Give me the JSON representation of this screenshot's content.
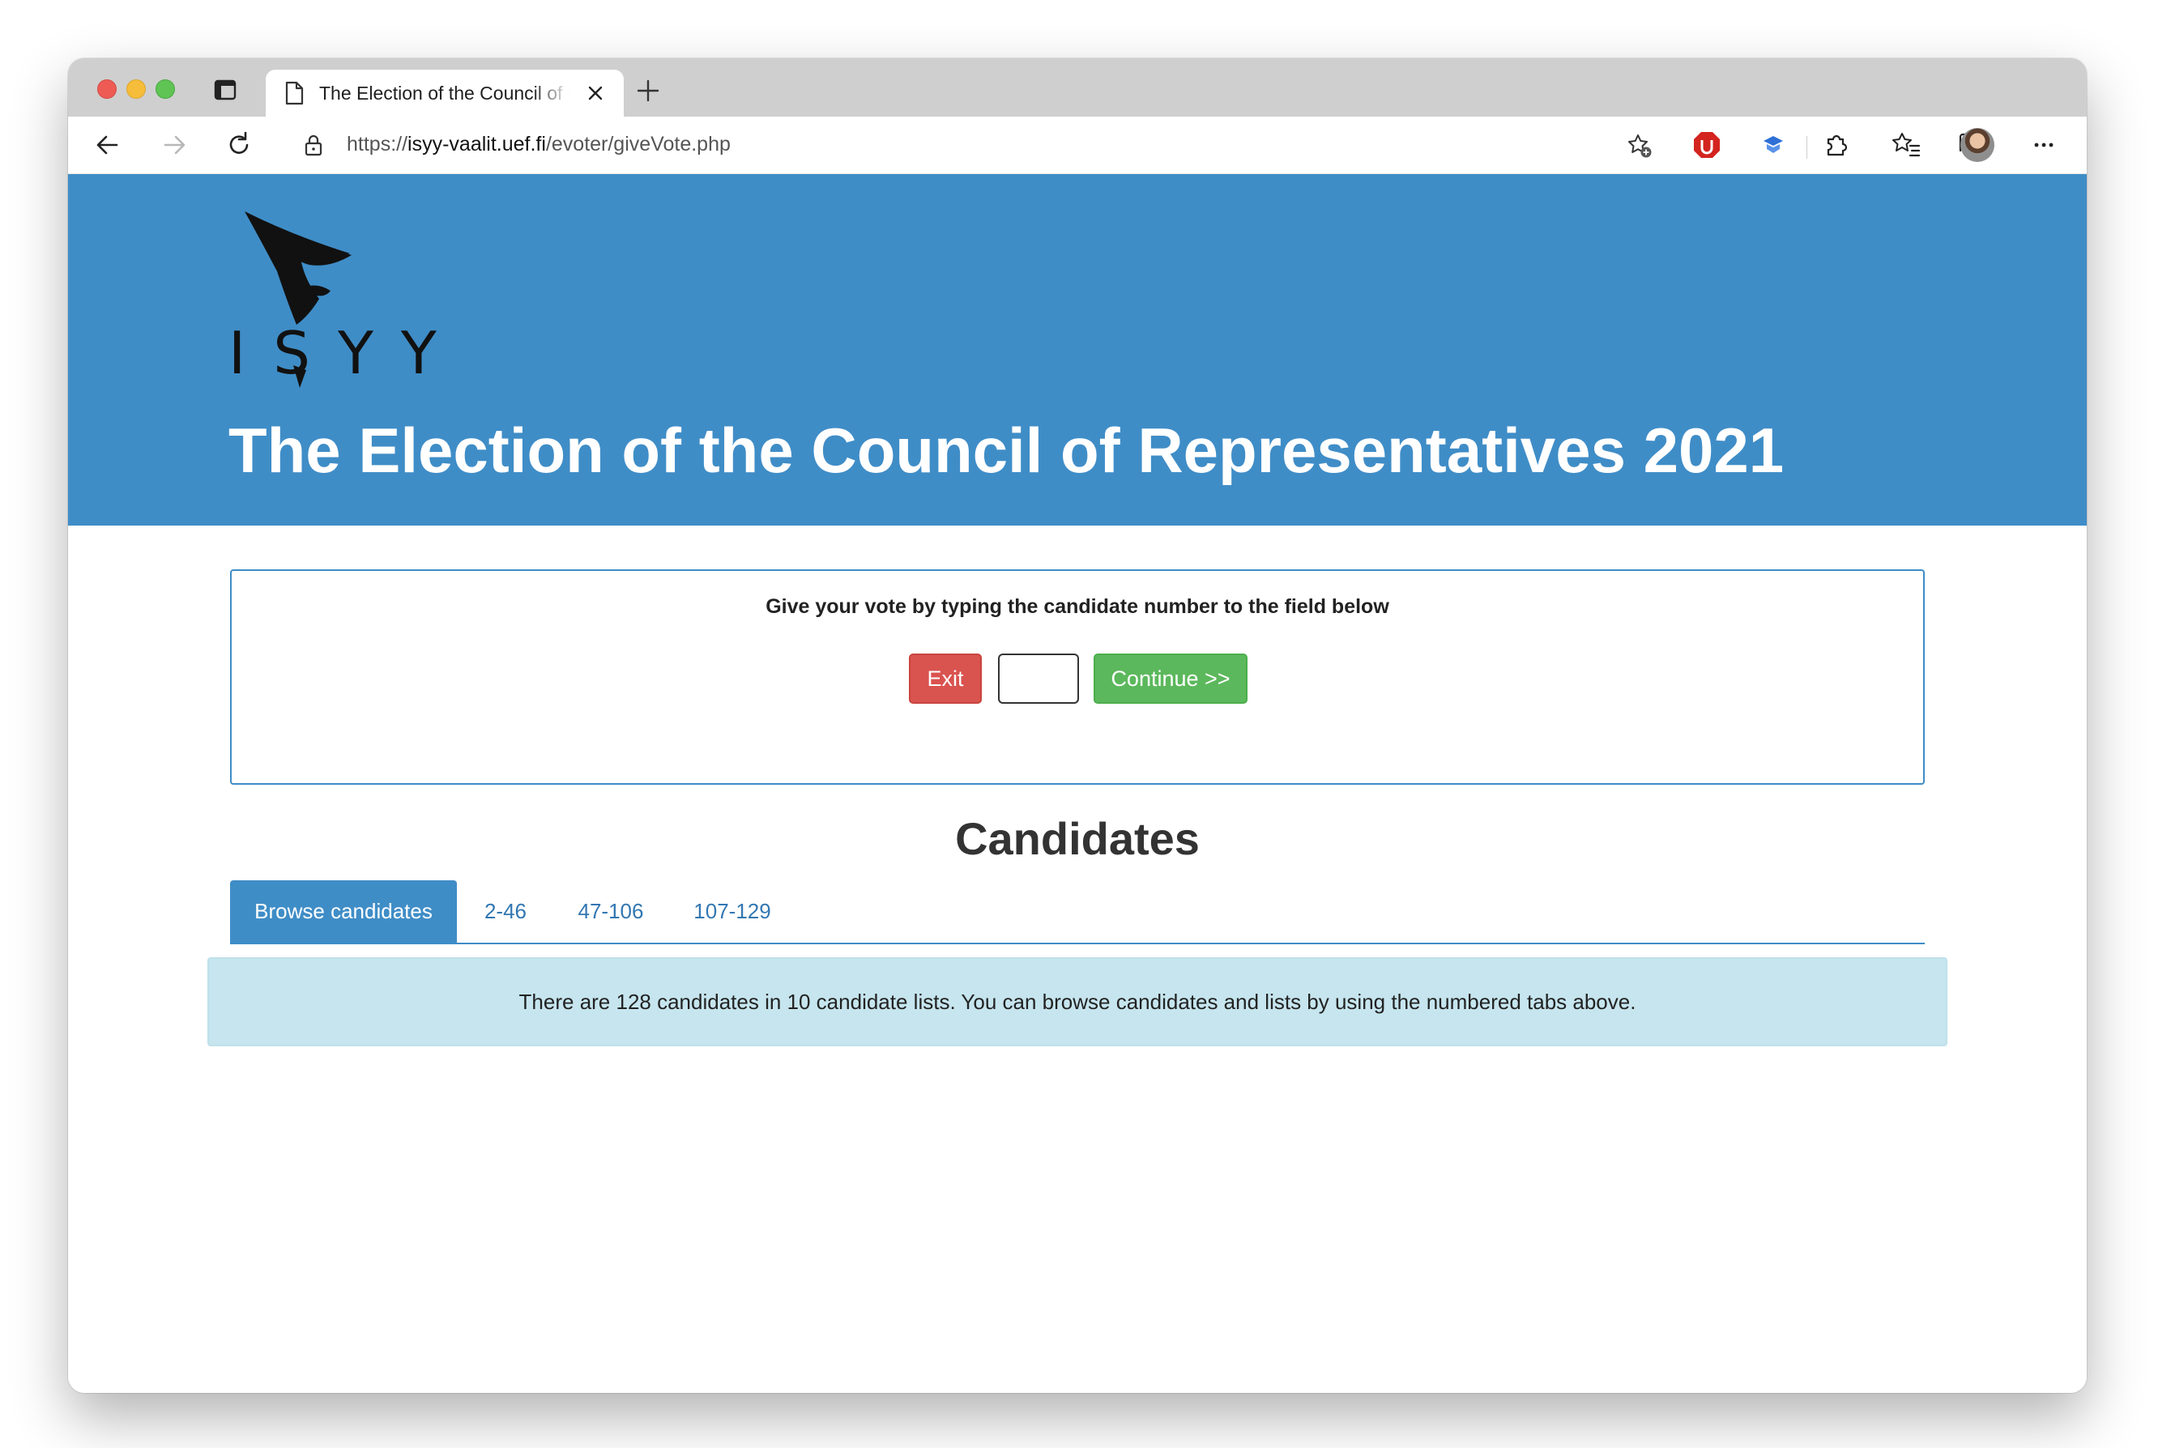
{
  "browser": {
    "tab_title": "The Election of the Council of Representatives 2021",
    "url_scheme": "https://",
    "url_host": "isyy-vaalit.uef.fi",
    "url_path": "/evoter/giveVote.php"
  },
  "icons": {
    "back": "arrow-left",
    "forward": "arrow-right",
    "reload": "reload",
    "lock": "lock",
    "favorite_add": "star-plus",
    "ext_adblock": "adblock-stop-icon",
    "ext_blue": "blue-extension-icon",
    "extensions": "puzzle",
    "favorites": "star-list",
    "collections": "collections",
    "profile": "avatar",
    "menu": "more-horizontal"
  },
  "colors": {
    "banner": "#3f8dc7",
    "exit": "#d9534f",
    "continue": "#5cb85c",
    "info_bg": "#c6e5ee"
  },
  "header": {
    "logo_text": "ISYY",
    "title": "The Election of the Council of Representatives 2021"
  },
  "vote": {
    "instruction": "Give your vote by typing the candidate number to the field below",
    "exit_label": "Exit",
    "input_value": "",
    "continue_label": "Continue >>"
  },
  "candidates": {
    "heading": "Candidates",
    "tabs": [
      {
        "label": "Browse candidates",
        "active": true
      },
      {
        "label": "2-46",
        "active": false
      },
      {
        "label": "47-106",
        "active": false
      },
      {
        "label": "107-129",
        "active": false
      }
    ],
    "info": "There are 128 candidates in 10 candidate lists. You can browse candidates and lists by using the numbered tabs above."
  }
}
